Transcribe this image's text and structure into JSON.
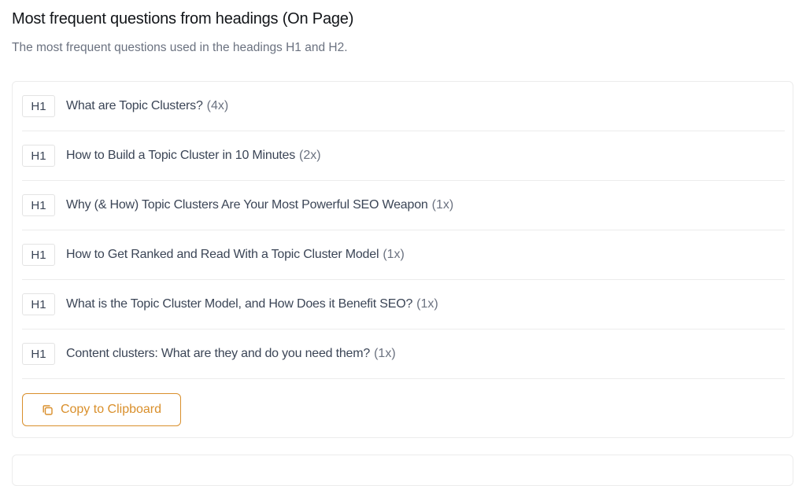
{
  "section": {
    "title": "Most frequent questions from headings (On Page)",
    "subtitle": "The most frequent questions used in the headings H1 and H2."
  },
  "questions": [
    {
      "tag": "H1",
      "text": "What are Topic Clusters?",
      "count": "(4x)"
    },
    {
      "tag": "H1",
      "text": "How to Build a Topic Cluster in 10 Minutes",
      "count": "(2x)"
    },
    {
      "tag": "H1",
      "text": "Why (& How) Topic Clusters Are Your Most Powerful SEO Weapon",
      "count": "(1x)"
    },
    {
      "tag": "H1",
      "text": "How to Get Ranked and Read With a Topic Cluster Model",
      "count": "(1x)"
    },
    {
      "tag": "H1",
      "text": "What is the Topic Cluster Model, and How Does it Benefit SEO?",
      "count": "(1x)"
    },
    {
      "tag": "H1",
      "text": "Content clusters: What are they and do you need them?",
      "count": "(1x)"
    }
  ],
  "copy_button": {
    "label": "Copy to Clipboard",
    "icon": "copy-icon"
  },
  "colors": {
    "accent": "#d98f2b",
    "text": "#3b4556",
    "muted": "#6b7280",
    "border": "#ececec"
  }
}
